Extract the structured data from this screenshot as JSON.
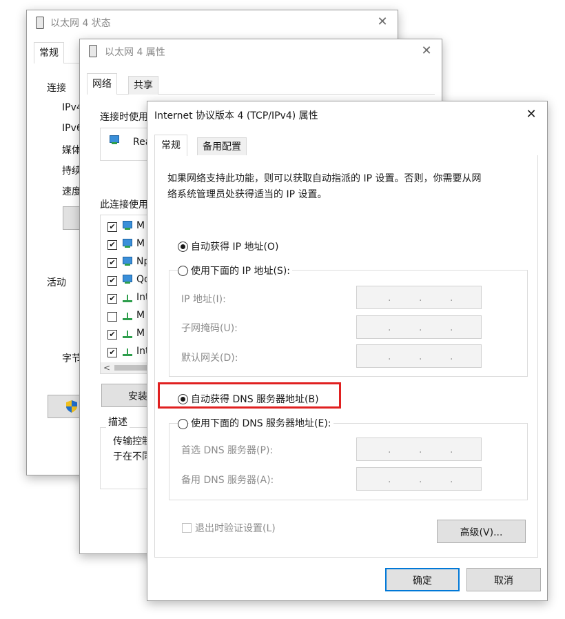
{
  "status_window": {
    "title": "以太网 4 状态",
    "tab_general": "常规",
    "section_connection": "连接",
    "rows": [
      "IPv4",
      "IPv6",
      "媒体",
      "持续",
      "速度"
    ],
    "section_activity": "活动",
    "bytes_label": "字节"
  },
  "props_window": {
    "title": "以太网 4 属性",
    "tab_network": "网络",
    "tab_sharing": "共享",
    "connect_using_label": "连接时使用",
    "adapter_name": "Rea",
    "items_label": "此连接使用",
    "items": [
      {
        "label": "M",
        "checked": true,
        "icon": "network-client-icon"
      },
      {
        "label": "M",
        "checked": true,
        "icon": "network-client-icon"
      },
      {
        "label": "Np",
        "checked": true,
        "icon": "network-client-icon"
      },
      {
        "label": "Qo",
        "checked": true,
        "icon": "network-client-icon"
      },
      {
        "label": "Int",
        "checked": true,
        "icon": "protocol-icon"
      },
      {
        "label": "M",
        "checked": false,
        "icon": "protocol-icon"
      },
      {
        "label": "M",
        "checked": true,
        "icon": "protocol-icon"
      },
      {
        "label": "Int",
        "checked": true,
        "icon": "protocol-icon"
      }
    ],
    "install_button": "安装",
    "description_label": "描述",
    "description_text_1": "传输控制",
    "description_text_2": "于在不同"
  },
  "ipv4_dialog": {
    "title": "Internet 协议版本 4 (TCP/IPv4) 属性",
    "tab_general": "常规",
    "tab_alternate": "备用配置",
    "intro_line1": "如果网络支持此功能，则可以获取自动指派的 IP 设置。否则，你需要从网",
    "intro_line2": "络系统管理员处获得适当的 IP 设置。",
    "radio_auto_ip": "自动获得 IP 地址(O)",
    "radio_manual_ip": "使用下面的 IP 地址(S):",
    "ip_address_label": "IP 地址(I):",
    "subnet_label": "子网掩码(U):",
    "gateway_label": "默认网关(D):",
    "radio_auto_dns": "自动获得 DNS 服务器地址(B)",
    "radio_manual_dns": "使用下面的 DNS 服务器地址(E):",
    "preferred_dns_label": "首选 DNS 服务器(P):",
    "alternate_dns_label": "备用 DNS 服务器(A):",
    "validate_checkbox": "退出时验证设置(L)",
    "advanced_button": "高级(V)...",
    "ok_button": "确定",
    "cancel_button": "取消",
    "ip_dot": "."
  },
  "colors": {
    "highlight_box": "#e02020",
    "default_button_border": "#0078d7"
  }
}
